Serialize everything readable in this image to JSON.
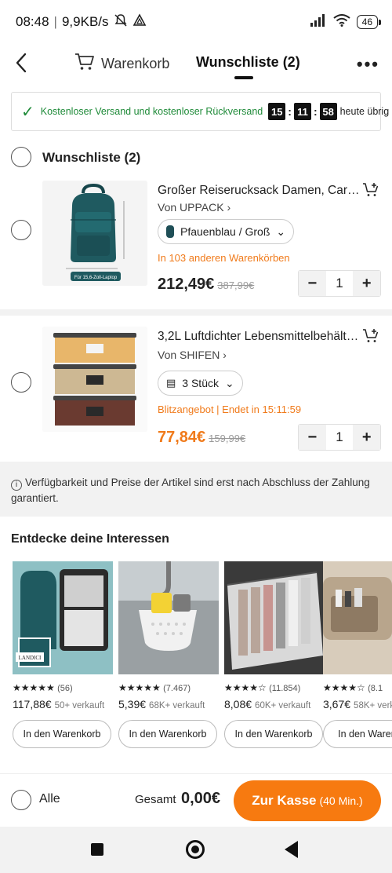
{
  "status_bar": {
    "time": "08:48",
    "speed": "9,9KB/s",
    "battery": "46"
  },
  "header": {
    "cart_tab": "Warenkorb",
    "wishlist_tab": "Wunschliste (2)"
  },
  "banner": {
    "message": "Kostenloser Versand und kostenloser Rückversand",
    "timer": [
      "15",
      "11",
      "58"
    ],
    "suffix": "heute übrig"
  },
  "wishlist": {
    "title": "Wunschliste (2)",
    "items": [
      {
        "name": "Großer Reiserucksack Damen, Carry-on...",
        "seller": "Von UPPACK",
        "variant": "Pfauenblau / Groß",
        "note": "In 103 anderen Warenkörben",
        "price": "212,49€",
        "old_price": "387,99€",
        "qty": "1",
        "thumb_caption": "Für 15,6-Zoll-Laptop"
      },
      {
        "name": "3,2L Luftdichter Lebensmittelbehälter...",
        "seller": "Von SHIFEN",
        "variant": "3 Stück",
        "note": "Blitzangebot | Endet in 15:11:59",
        "price": "77,84€",
        "old_price": "159,99€",
        "qty": "1"
      }
    ]
  },
  "info_text": "Verfügbarkeit und Preise der Artikel sind erst nach Abschluss der Zahlung garantiert.",
  "discover": {
    "title": "Entdecke deine Interessen",
    "items": [
      {
        "stars": "★★★★★",
        "reviews": "(56)",
        "price": "117,88€",
        "sold": "50+ verkauft",
        "button": "In den Warenkorb",
        "brand": "LANDICI"
      },
      {
        "stars": "★★★★★",
        "reviews": "(7.467)",
        "price": "5,39€",
        "sold": "68K+ verkauft",
        "button": "In den Warenkorb"
      },
      {
        "stars": "★★★★☆",
        "reviews": "(11.854)",
        "price": "8,08€",
        "sold": "60K+ verkauft",
        "button": "In den Warenkorb"
      },
      {
        "stars": "★★★★☆",
        "reviews": "(8.1",
        "price": "3,67€",
        "sold": "58K+ verka",
        "button": "In den Warenko"
      }
    ]
  },
  "footer": {
    "all_label": "Alle",
    "total_label": "Gesamt",
    "total": "0,00€",
    "checkout": "Zur Kasse",
    "checkout_time": "(40 Min.)"
  },
  "colors": {
    "accent": "#f77a10",
    "success": "#1e8a38",
    "product_teal": "#1f4f57"
  }
}
